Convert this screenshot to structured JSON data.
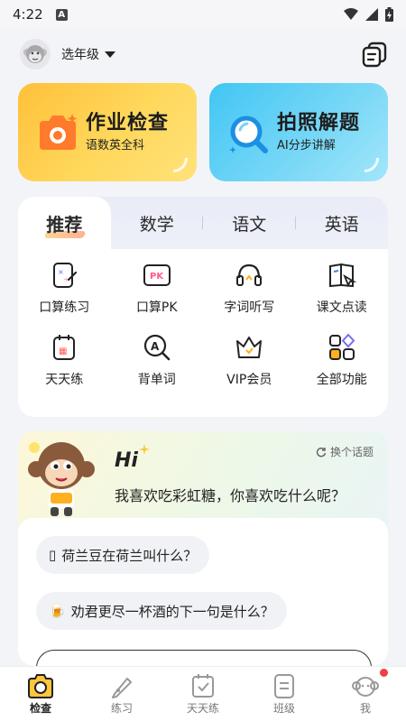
{
  "status_bar": {
    "time": "4:22",
    "badge": "A"
  },
  "header": {
    "grade_selector": "选年级"
  },
  "feature_cards": [
    {
      "title": "作业检查",
      "subtitle": "语数英全科",
      "icon": "camera-icon",
      "color": "#ffc53d"
    },
    {
      "title": "拍照解题",
      "subtitle": "AI分步讲解",
      "icon": "magnifier-icon",
      "color": "#45c7f4"
    }
  ],
  "subject_tabs": [
    {
      "label": "推荐",
      "active": true
    },
    {
      "label": "数学",
      "active": false
    },
    {
      "label": "语文",
      "active": false
    },
    {
      "label": "英语",
      "active": false
    }
  ],
  "functions": [
    {
      "label": "口算练习",
      "icon": "oral-calc-icon"
    },
    {
      "label": "口算PK",
      "icon": "pk-icon"
    },
    {
      "label": "字词听写",
      "icon": "headphones-icon"
    },
    {
      "label": "课文点读",
      "icon": "book-point-icon"
    },
    {
      "label": "天天练",
      "icon": "calendar-icon"
    },
    {
      "label": "背单词",
      "icon": "word-search-icon"
    },
    {
      "label": "VIP会员",
      "icon": "vip-icon"
    },
    {
      "label": "全部功能",
      "icon": "grid-icon"
    }
  ],
  "chat": {
    "greeting": "Hi",
    "change_topic": "换个话题",
    "question": "我喜欢吃彩虹糖，你喜欢吃什么呢？",
    "suggestions": [
      {
        "text": "荷兰豆在荷兰叫什么？",
        "emoji": "▯"
      },
      {
        "text": "劝君更尽一杯酒的下一句是什么？",
        "emoji": "🍺"
      }
    ]
  },
  "bottom_nav": [
    {
      "label": "检查",
      "icon": "camera-icon",
      "active": true
    },
    {
      "label": "练习",
      "icon": "pencil-tag-icon",
      "active": false
    },
    {
      "label": "天天练",
      "icon": "check-calendar-icon",
      "active": false
    },
    {
      "label": "班级",
      "icon": "class-icon",
      "active": false
    },
    {
      "label": "我",
      "icon": "profile-icon",
      "active": false
    }
  ],
  "colors": {
    "accent_yellow": "#ffc53d",
    "accent_blue": "#45c7f4",
    "notification": "#f23f3f"
  }
}
